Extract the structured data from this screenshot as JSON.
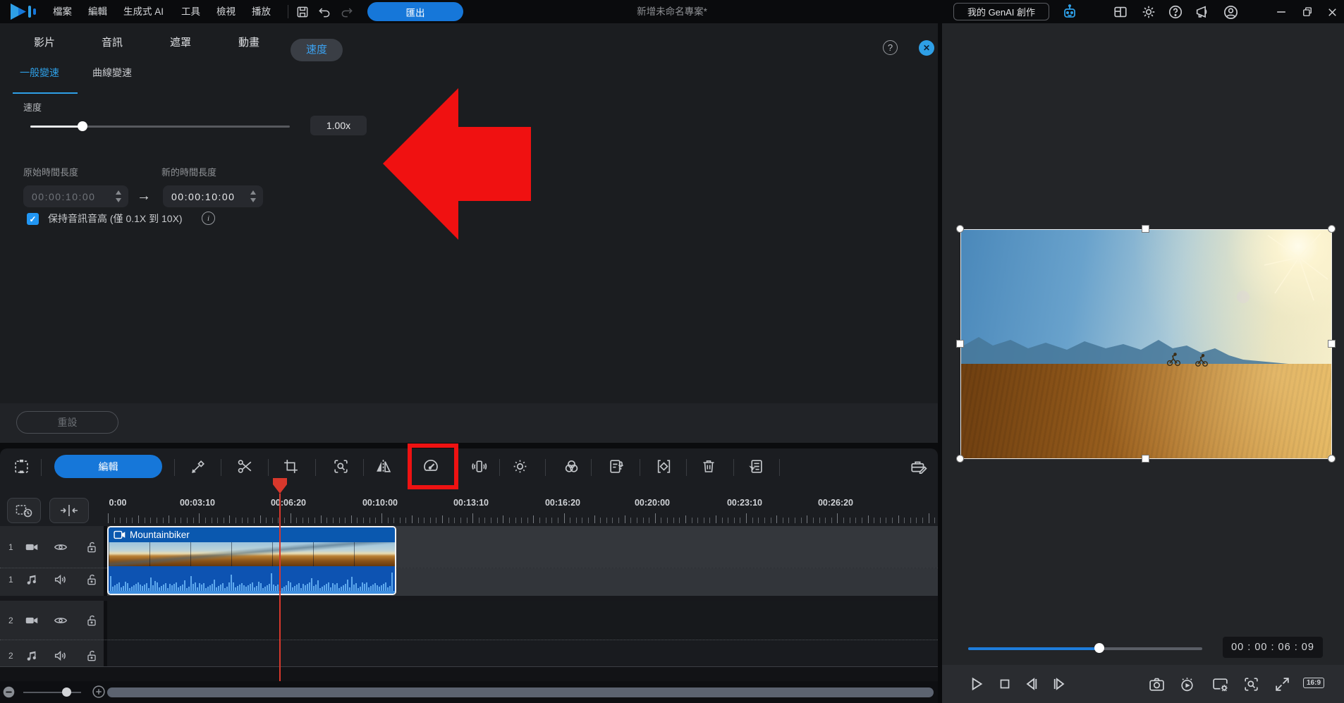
{
  "menubar": {
    "menus": [
      "檔案",
      "編輯",
      "生成式 AI",
      "工具",
      "檢視",
      "播放"
    ],
    "export_label": "匯出",
    "project_title": "新增未命名專案*",
    "genai_button_label": "我的 GenAI 創作"
  },
  "properties_panel": {
    "tabs": [
      "影片",
      "音訊",
      "遮罩",
      "動畫",
      "速度"
    ],
    "active_tab": "速度",
    "subtabs": [
      "一般變速",
      "曲線變速"
    ],
    "active_subtab": "一般變速",
    "speed": {
      "label": "速度",
      "value": "1.00x",
      "slider_percent": 20
    },
    "duration": {
      "original_label": "原始時間長度",
      "original_value": "00:00:10:00",
      "new_label": "新的時間長度",
      "new_value": "00:00:10:00",
      "arrow_glyph": "→"
    },
    "pitch": {
      "checked": true,
      "check_glyph": "✓",
      "label": "保持音訊音高 (僅 0.1X 到 10X)"
    },
    "reset_label": "重設",
    "help_glyph": "?",
    "close_glyph": "✕",
    "info_glyph": "i"
  },
  "toolbar": {
    "edit_label": "編輯"
  },
  "timeline": {
    "ruler_labels": [
      "0:00",
      "00:03:10",
      "00:06:20",
      "00:10:00",
      "00:13:10",
      "00:16:20",
      "00:20:00",
      "00:23:10",
      "00:26:20"
    ],
    "tracks": [
      {
        "number": "1",
        "type": "video"
      },
      {
        "number": "1",
        "type": "audio"
      },
      {
        "number": "2",
        "type": "video"
      },
      {
        "number": "2",
        "type": "audio"
      }
    ],
    "clip_name": "Mountainbiker",
    "zoom_slider_percent": 74
  },
  "preview": {
    "timecode": "00 : 00 : 06 : 09",
    "seek_percent": 56,
    "aspect_label": "16:9"
  },
  "annotations": {
    "arrow_color": "#f01111",
    "box_color": "#ee1212"
  }
}
